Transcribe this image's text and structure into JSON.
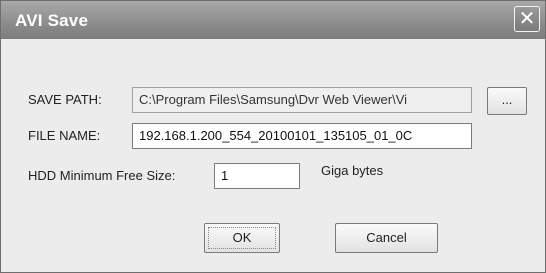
{
  "dialog": {
    "title": "AVI Save",
    "close_icon": "close-icon"
  },
  "save_path": {
    "label": "SAVE PATH:",
    "value": "C:\\Program Files\\Samsung\\Dvr Web Viewer\\Vi",
    "browse_label": "..."
  },
  "file_name": {
    "label": "FILE NAME:",
    "value": "192.168.1.200_554_20100101_135105_01_0C"
  },
  "hdd_min": {
    "label": "HDD Minimum Free Size:",
    "value": "1",
    "unit": "Giga bytes"
  },
  "buttons": {
    "ok_label": "OK",
    "cancel_label": "Cancel"
  }
}
